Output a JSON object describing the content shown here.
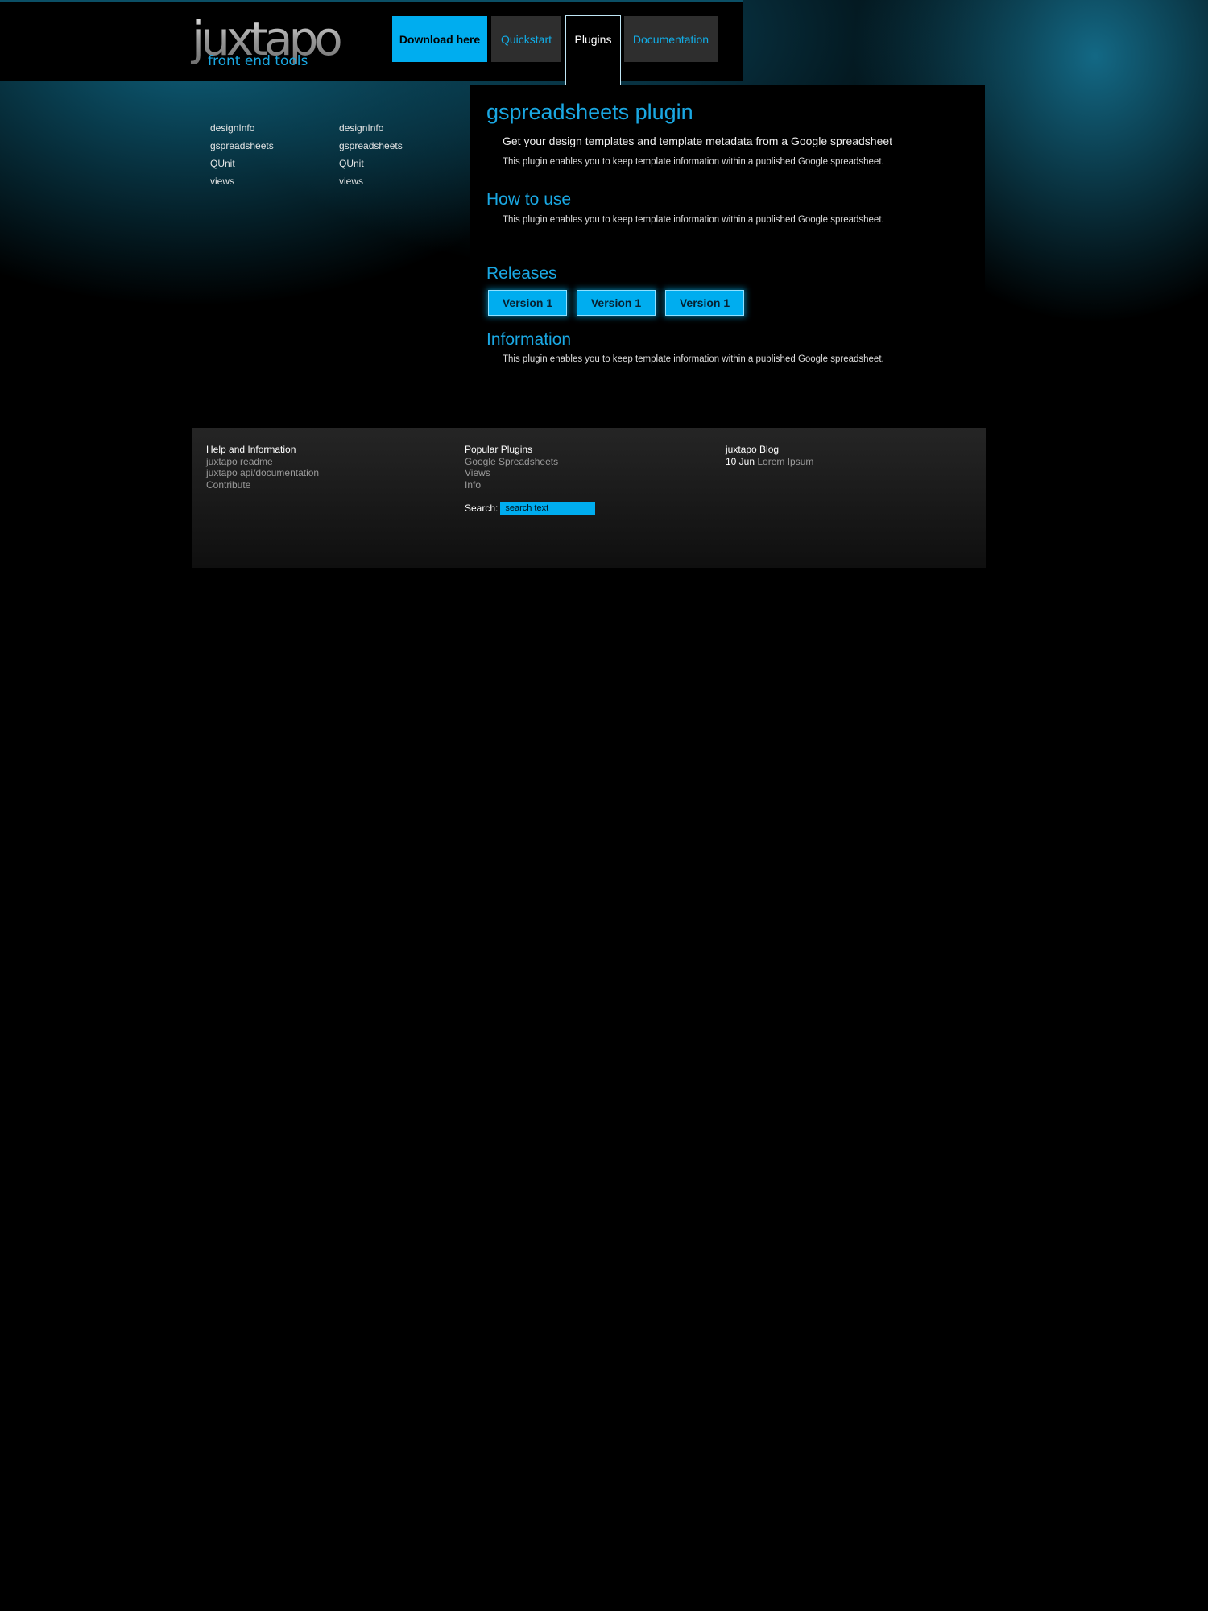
{
  "brand": {
    "logo_text": "juxtapo",
    "logo_tagline": "front end tools"
  },
  "nav": {
    "download": "Download here",
    "quickstart": "Quickstart",
    "plugins": "Plugins",
    "documentation": "Documentation"
  },
  "sidebar": {
    "col1": [
      "designInfo",
      "gspreadsheets",
      "QUnit",
      "views"
    ],
    "col2": [
      "designInfo",
      "gspreadsheets",
      "QUnit",
      "views"
    ]
  },
  "main": {
    "title": "gspreadsheets plugin",
    "tagline": "Get your design templates and template metadata from a Google spreadsheet",
    "intro": "This plugin enables you to keep template information within a published Google spreadsheet.",
    "howto_heading": "How to use",
    "howto_text": "This plugin enables you to keep template information within a published Google spreadsheet.",
    "releases_heading": "Releases",
    "releases": [
      "Version 1",
      "Version 1",
      "Version 1"
    ],
    "info_heading": "Information",
    "info_text": "This plugin enables you to keep template information within a published Google spreadsheet."
  },
  "footer": {
    "help_heading": "Help and Information",
    "help_links": [
      "juxtapo readme",
      "juxtapo api/documentation",
      "Contribute"
    ],
    "popular_heading": "Popular Plugins",
    "popular_links": [
      "Google Spreadsheets",
      "Views",
      "Info"
    ],
    "search_label": "Search:",
    "search_value": "search text",
    "blog_heading": "juxtapo Blog",
    "blog_date": "10 Jun",
    "blog_title": "Lorem Ipsum"
  },
  "colors": {
    "accent": "#00adef",
    "heading": "#1aa8e3",
    "tab_bg": "#2e2e2e"
  }
}
